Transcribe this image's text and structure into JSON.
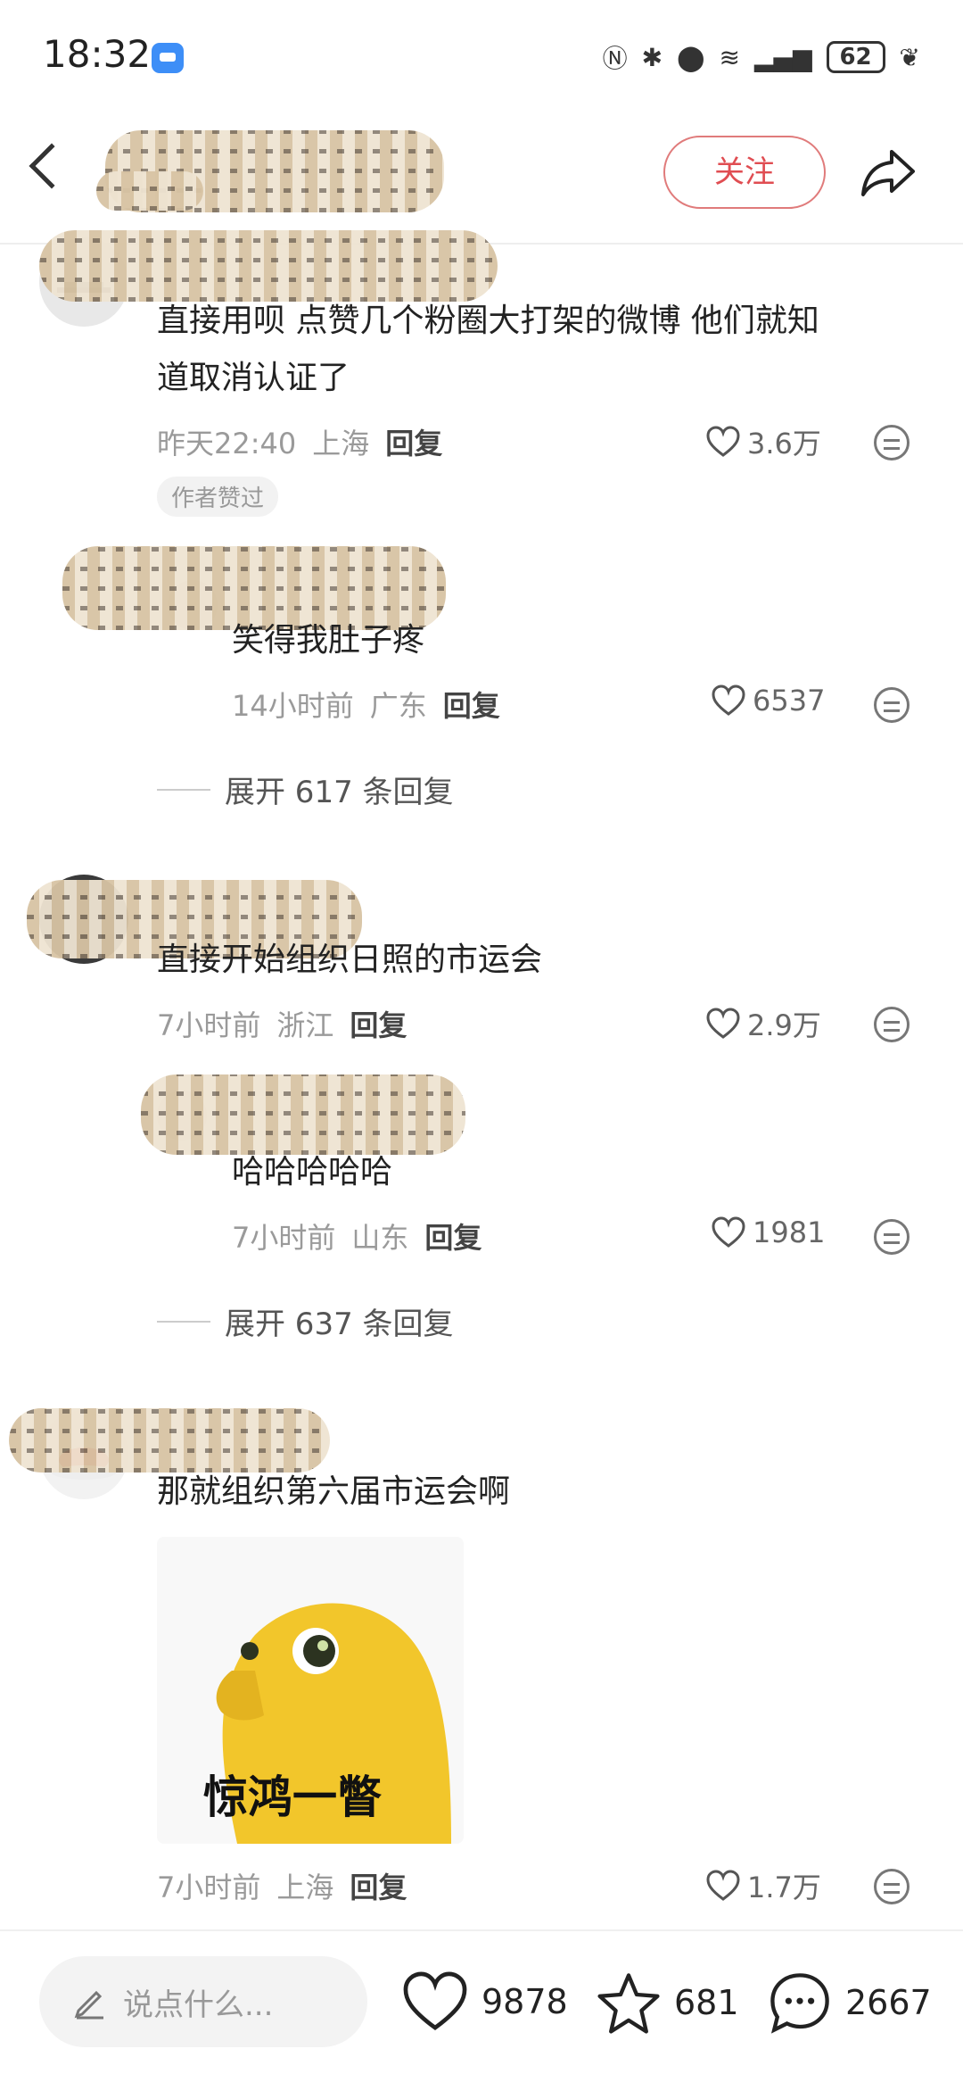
{
  "status_bar": {
    "time": "18:32",
    "battery": "62"
  },
  "header": {
    "follow_label": "关注"
  },
  "comments": [
    {
      "text_line1": "直接用呗  点赞几个粉圈大打架的微博  他们就知",
      "text_line2": "道取消认证了",
      "time": "昨天22:40",
      "location": "上海",
      "reply_label": "回复",
      "likes": "3.6万",
      "badge": "作者赞过",
      "sub_reply": {
        "text": "笑得我肚子疼",
        "time": "14小时前",
        "location": "广东",
        "reply_label": "回复",
        "likes": "6537"
      },
      "expand": "展开 617 条回复"
    },
    {
      "text_line1": "直接开始组织日照的市运会",
      "time": "7小时前",
      "location": "浙江",
      "reply_label": "回复",
      "likes": "2.9万",
      "sub_reply": {
        "text": "哈哈哈哈哈",
        "time": "7小时前",
        "location": "山东",
        "reply_label": "回复",
        "likes": "1981"
      },
      "expand": "展开 637 条回复"
    },
    {
      "text_line1": "那就组织第六届市运会啊",
      "sticker_text": "惊鸿一瞥",
      "time": "7小时前",
      "location": "上海",
      "reply_label": "回复",
      "likes": "1.7万"
    }
  ],
  "bottom_bar": {
    "input_placeholder": "说点什么...",
    "likes": "9878",
    "favorites": "681",
    "comments": "2667"
  },
  "colors": {
    "accent_red": "#e04d52",
    "muted": "#9a9a9a"
  }
}
